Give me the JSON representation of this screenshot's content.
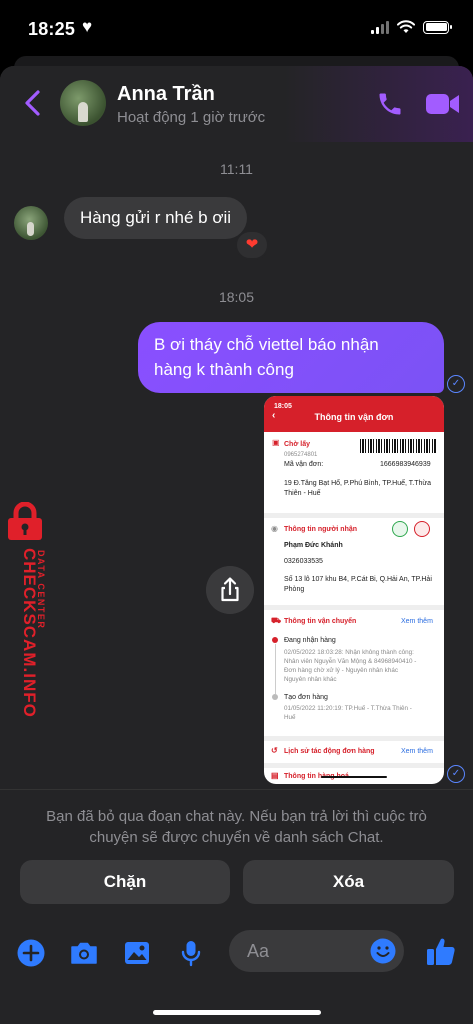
{
  "status_bar": {
    "time": "18:25",
    "heart": "♥"
  },
  "header": {
    "contact_name": "Anna Trần",
    "activity": "Hoạt động 1 giờ trước"
  },
  "conversation": {
    "time_1": "11:11",
    "incoming_message": "Hàng gửi r nhé b ơii",
    "reaction": "❤",
    "time_2": "18:05",
    "outgoing_line_1": "B ơi tháy chỗ viettel báo nhận",
    "outgoing_line_2": "hàng k thành công"
  },
  "attachment": {
    "time": "18:05",
    "title": "Thông tin vận đơn",
    "section_pickup": "Chờ lấy",
    "phone_partial": "0965274801",
    "tracking_label": "Mã vận đơn:",
    "tracking_number": "1666983946939",
    "sender_address_1": "19 Đ.Tăng Bạt Hổ, P.Phú Bình, TP.Huế, T.Thừa",
    "sender_address_2": "Thiên - Huế",
    "section_receiver": "Thông tin người nhận",
    "receiver_name": "Phạm Đức Khánh",
    "receiver_phone": "0326033535",
    "receiver_address_1": "Số 13 lô 107 khu B4, P.Cát Bi, Q.Hải An, TP.Hải",
    "receiver_address_2": "Phòng",
    "section_shipping": "Thông tin vận chuyển",
    "see_more": "Xem thêm",
    "status_1": "Đang nhận hàng",
    "status_1_detail_1": "02/05/2022 18:03:28: Nhận không thành công:",
    "status_1_detail_2": "Nhân viên Nguyễn Văn Mộng & 84968940410 -",
    "status_1_detail_3": "Đơn hàng chờ xử lý - Nguyên nhân khác",
    "status_1_detail_4": "Nguyên nhân khác",
    "status_2": "Tạo đơn hàng",
    "status_2_detail_1": "01/05/2022 11:20:19: TP.Huế - T.Thừa Thiên -",
    "status_2_detail_2": "Huế",
    "section_history": "Lịch sử tác động đơn hàng",
    "see_more_2": "Xem thêm",
    "section_goods": "Thông tin hàng hoá"
  },
  "notice": "Bạn đã bỏ qua đoạn chat này. Nếu bạn trả lời thì cuộc trò chuyện sẽ được chuyển về danh sách Chat.",
  "actions": {
    "block_label": "Chặn",
    "delete_label": "Xóa"
  },
  "composer": {
    "placeholder": "Aa"
  },
  "watermark": {
    "brand": "CHECKSCAM.INFO",
    "subtitle": "DATA CENTER"
  },
  "colors": {
    "accent": "#8a4fff",
    "blue": "#2f7bff",
    "header_icon": "#a25cff",
    "viettel_red": "#d6202a"
  }
}
